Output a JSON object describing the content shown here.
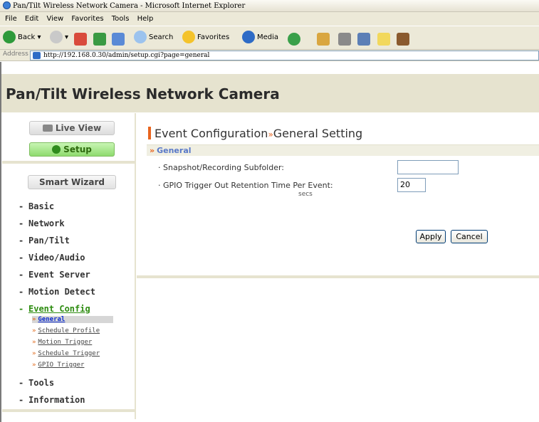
{
  "browser": {
    "title": "Pan/Tilt Wireless Network Camera - Microsoft Internet Explorer",
    "menu": [
      "File",
      "Edit",
      "View",
      "Favorites",
      "Tools",
      "Help"
    ],
    "toolbar": {
      "back": "Back",
      "search": "Search",
      "favorites": "Favorites",
      "media": "Media"
    },
    "address_label": "Address",
    "address_value": "http://192.168.0.30/admin/setup.cgi?page=general"
  },
  "header": {
    "title": "Pan/Tilt Wireless Network Camera"
  },
  "sidebar": {
    "live_view": "Live View",
    "setup": "Setup",
    "smart_wizard": "Smart Wizard",
    "nav": [
      {
        "label": "Basic"
      },
      {
        "label": "Network"
      },
      {
        "label": "Pan/Tilt"
      },
      {
        "label": "Video/Audio"
      },
      {
        "label": "Event Server"
      },
      {
        "label": "Motion Detect"
      },
      {
        "label": "Event Config"
      },
      {
        "label": "Tools"
      },
      {
        "label": "Information"
      }
    ],
    "dash": "-",
    "sub_items": [
      {
        "label": "General"
      },
      {
        "label": "Schedule Profile"
      },
      {
        "label": "Motion Trigger"
      },
      {
        "label": "Schedule Trigger"
      },
      {
        "label": "GPIO Trigger"
      }
    ],
    "sub_arrow": "»"
  },
  "content": {
    "heading_part1": "Event Configuration",
    "heading_sep": "»",
    "heading_part2": "General Setting",
    "section_title": "General",
    "section_arrow": "»",
    "fields": {
      "snapshot_label": "· Snapshot/Recording Subfolder:",
      "snapshot_value": "",
      "gpio_label": "· GPIO Trigger Out Retention Time Per Event:",
      "gpio_value": "20",
      "gpio_unit": "secs"
    },
    "apply_label": "Apply",
    "cancel_label": "Cancel"
  },
  "colors": {
    "accent": "#e8641e",
    "band": "#e6e3cf",
    "setup_green": "#8edb6e",
    "link_blue": "#0b2bd0"
  }
}
